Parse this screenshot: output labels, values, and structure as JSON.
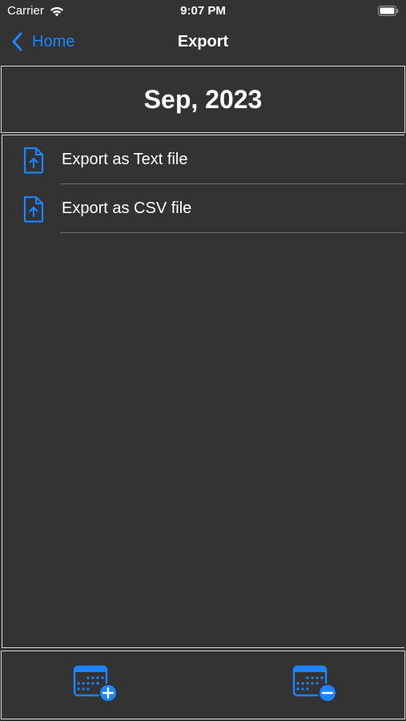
{
  "status_bar": {
    "carrier": "Carrier",
    "time": "9:07 PM",
    "wifi_icon": "wifi-icon",
    "battery_icon": "battery-icon"
  },
  "nav": {
    "back_label": "Home",
    "title": "Export"
  },
  "header": {
    "month": "Sep, 2023"
  },
  "export_options": [
    {
      "label": "Export as Text file",
      "icon": "file-upload-icon"
    },
    {
      "label": "Export as CSV file",
      "icon": "file-upload-icon"
    }
  ],
  "toolbar": {
    "add_icon": "calendar-add-icon",
    "remove_icon": "calendar-remove-icon"
  },
  "colors": {
    "accent": "#1a85ff",
    "background": "#333333",
    "text": "#ffffff",
    "border": "#d8d8d8",
    "separator": "#6e6e6e"
  }
}
